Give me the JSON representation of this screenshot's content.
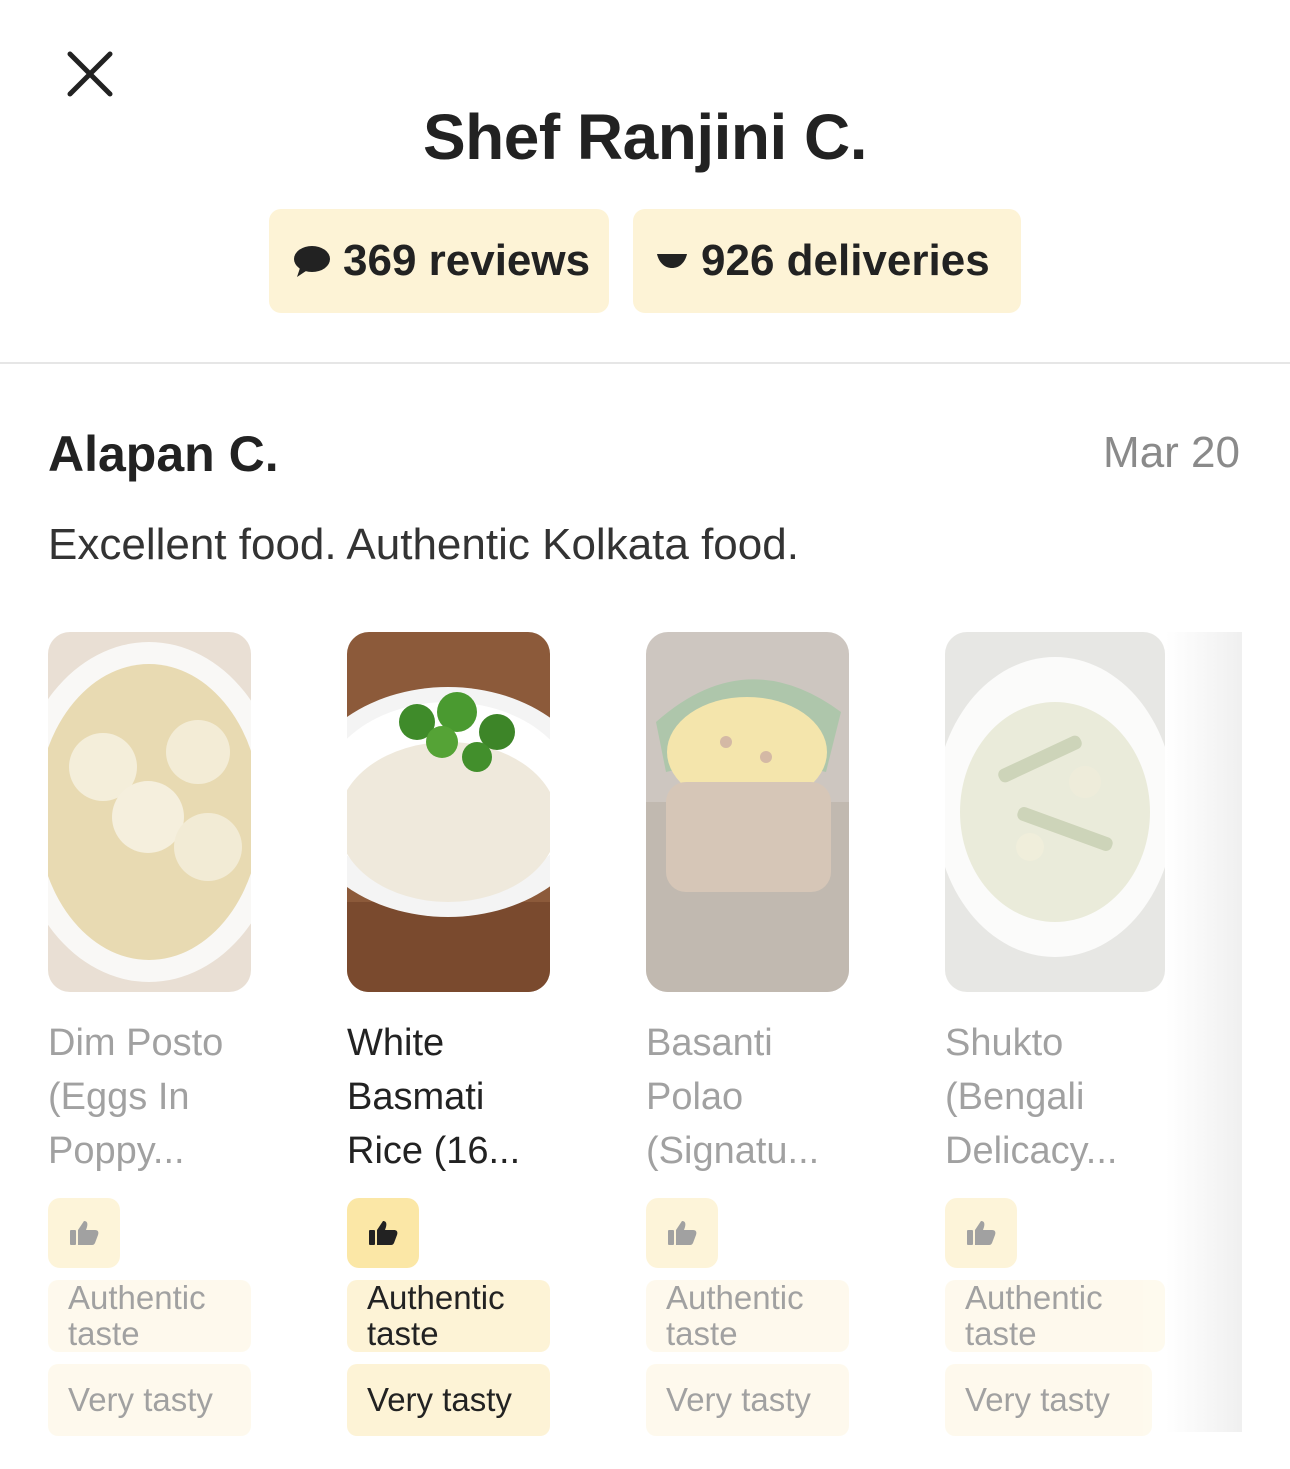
{
  "header": {
    "close_icon": "close-icon",
    "title": "Shef Ranjini C.",
    "reviews_label": "369 reviews",
    "deliveries_label": "926 deliveries"
  },
  "review": {
    "reviewer": "Alapan C.",
    "date": "Mar 20",
    "text": "Excellent food. Authentic Kolkata food."
  },
  "dishes": [
    {
      "name": "Dim Posto (Eggs In Poppy...",
      "tags": [
        "Authentic taste",
        "Very tasty"
      ]
    },
    {
      "name": "White Basmati Rice (16...",
      "tags": [
        "Authentic taste",
        "Very tasty"
      ]
    },
    {
      "name": "Basanti Polao (Signatu...",
      "tags": [
        "Authentic taste",
        "Very tasty"
      ]
    },
    {
      "name": "Shukto (Bengali Delicacy...",
      "tags": [
        "Authentic taste",
        "Very tasty"
      ]
    }
  ],
  "colors": {
    "pill_bg": "#fdf3d6",
    "thumb_bg": "#fbe7a6",
    "text": "#222222",
    "muted": "#8a8a8a"
  }
}
